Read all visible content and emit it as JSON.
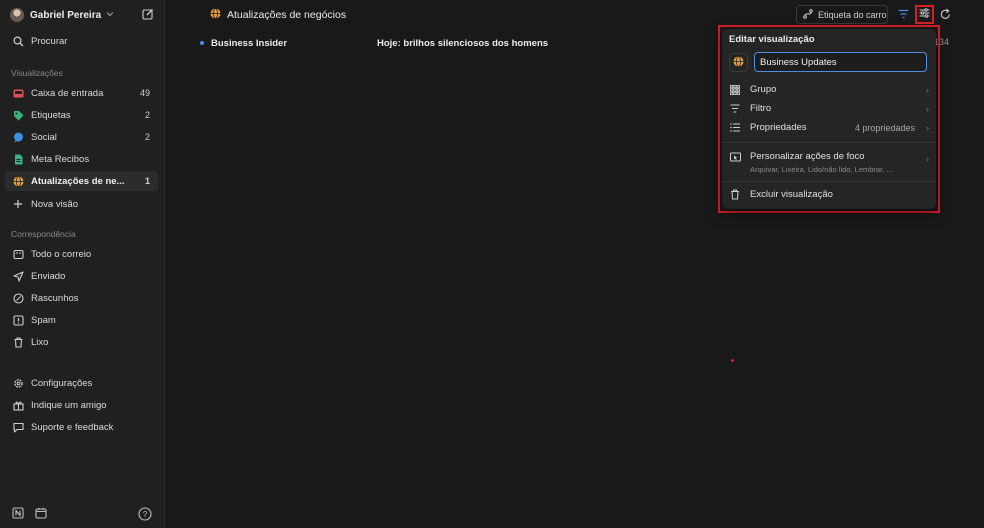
{
  "sidebar": {
    "profile_name": "Gabriel Pereira",
    "search_label": "Procurar",
    "views_label": "Visualizações",
    "views": [
      {
        "label": "Caixa de entrada",
        "count": "49"
      },
      {
        "label": "Etiquetas",
        "count": "2"
      },
      {
        "label": "Social",
        "count": "2"
      },
      {
        "label": "Meta Recibos",
        "count": ""
      },
      {
        "label": "Atualizações de ne...",
        "count": "1"
      }
    ],
    "new_view_label": "Nova visão",
    "mail_label": "Correspondência",
    "mail_items": [
      {
        "label": "Todo o correio"
      },
      {
        "label": "Enviado"
      },
      {
        "label": "Rascunhos"
      },
      {
        "label": "Spam"
      },
      {
        "label": "Lixo"
      }
    ],
    "footer_items": [
      {
        "label": "Configurações"
      },
      {
        "label": "Indique um amigo"
      },
      {
        "label": "Suporte e feedback"
      }
    ],
    "help_icon": "?"
  },
  "header": {
    "title": "Atualizações de negócios",
    "tag_button": "Etiqueta do carro"
  },
  "messages": [
    {
      "sender": "Business Insider",
      "subject": "Hoje: brilhos silenciosos dos homens",
      "time": "134"
    }
  ],
  "popup": {
    "title": "Editar visualização",
    "name_value": "Business Updates",
    "group_label": "Grupo",
    "filter_label": "Filtro",
    "properties_label": "Propriedades",
    "properties_value": "4 propriedades",
    "focus_label": "Personalizar ações de foco",
    "focus_sub": "Arquivar, Lixeira, Lido/não lido, Lembrar, ...",
    "delete_label": "Excluir visualização",
    "arrow": "›"
  },
  "colors": {
    "accent_blue": "#4a8fe0",
    "highlight_red": "#d71f26",
    "background": "#191919",
    "sidebar": "#202020"
  }
}
